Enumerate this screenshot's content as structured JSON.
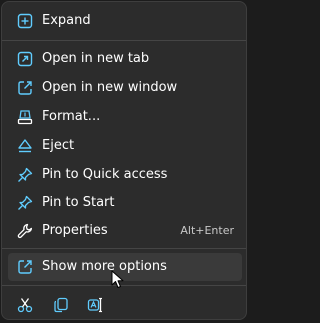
{
  "menu": {
    "accent_color": "#60cdff",
    "items": [
      {
        "label": "Expand",
        "icon": "expand-icon"
      },
      {
        "label": "Open in new tab",
        "icon": "open-in-new-tab-icon"
      },
      {
        "label": "Open in new window",
        "icon": "open-in-new-window-icon"
      },
      {
        "label": "Format...",
        "icon": "format-icon"
      },
      {
        "label": "Eject",
        "icon": "eject-icon"
      },
      {
        "label": "Pin to Quick access",
        "icon": "pin-icon"
      },
      {
        "label": "Pin to Start",
        "icon": "pin-icon"
      },
      {
        "label": "Properties",
        "icon": "wrench-icon",
        "shortcut": "Alt+Enter"
      },
      {
        "label": "Show more options",
        "icon": "show-more-options-icon"
      }
    ],
    "bottom_actions": [
      {
        "icon": "cut-icon"
      },
      {
        "icon": "copy-icon"
      },
      {
        "icon": "rename-icon"
      }
    ]
  }
}
